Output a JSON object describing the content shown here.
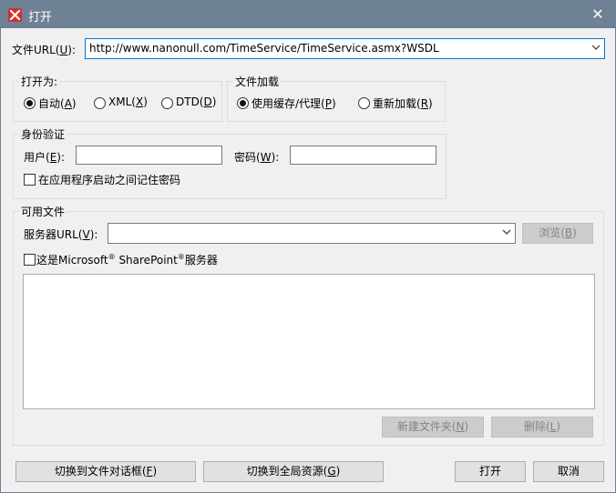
{
  "window": {
    "title": "打开",
    "close_glyph": "✕"
  },
  "url_row": {
    "label": "文件URL(",
    "label_key": "U",
    "label_end": "):",
    "value": "http://www.nanonull.com/TimeService/TimeService.asmx?WSDL"
  },
  "open_as": {
    "title": "打开为:",
    "options": [
      {
        "label": "自动(",
        "key": "A",
        "end": ")",
        "selected": true
      },
      {
        "label": "XML(",
        "key": "X",
        "end": ")",
        "selected": false
      },
      {
        "label": "DTD(",
        "key": "D",
        "end": ")",
        "selected": false
      }
    ]
  },
  "file_load": {
    "title": "文件加载",
    "options": [
      {
        "label": "使用缓存/代理(",
        "key": "P",
        "end": ")",
        "selected": true
      },
      {
        "label": "重新加载(",
        "key": "R",
        "end": ")",
        "selected": false
      }
    ]
  },
  "auth": {
    "title": "身份验证",
    "user_label": "用户(",
    "user_key": "E",
    "user_end": "):",
    "password_label": "密码(",
    "password_key": "W",
    "password_end": "):",
    "user_value": "",
    "password_value": "",
    "remember_label": "在应用程序启动之间记住密码",
    "remember_checked": false
  },
  "available_files": {
    "title": "可用文件",
    "server_label": "服务器URL(",
    "server_key": "V",
    "server_end": "):",
    "server_value": "",
    "browse_label": "浏览(",
    "browse_key": "B",
    "browse_end": ")",
    "sharepoint_label_1": "这是Microsoft",
    "sharepoint_label_2": " SharePoint",
    "sharepoint_label_3": "服务器",
    "reg_mark": "®",
    "sharepoint_checked": false,
    "new_folder_label": "新建文件夹(",
    "new_folder_key": "N",
    "new_folder_end": ")",
    "delete_label": "删除(",
    "delete_key": "L",
    "delete_end": ")"
  },
  "footer": {
    "switch_file_dialog": "切换到文件对话框(",
    "switch_file_dialog_key": "F",
    "switch_file_dialog_end": ")",
    "switch_global": "切换到全局资源(",
    "switch_global_key": "G",
    "switch_global_end": ")",
    "open": "打开",
    "cancel": "取消"
  },
  "colors": {
    "titlebar": "#6f8194",
    "focus": "#0078d7",
    "app_icon": "#d0312d"
  }
}
